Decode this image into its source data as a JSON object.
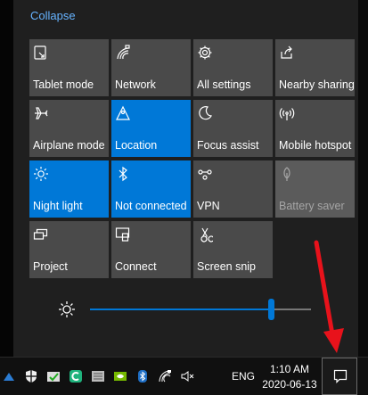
{
  "action_center": {
    "collapse_label": "Collapse",
    "tiles": [
      {
        "label": "Tablet mode",
        "state": "inactive",
        "icon": "tablet-mode-icon"
      },
      {
        "label": "Network",
        "state": "inactive",
        "icon": "network-icon"
      },
      {
        "label": "All settings",
        "state": "inactive",
        "icon": "gear-icon"
      },
      {
        "label": "Nearby sharing",
        "state": "inactive",
        "icon": "share-icon"
      },
      {
        "label": "Airplane mode",
        "state": "inactive",
        "icon": "airplane-icon"
      },
      {
        "label": "Location",
        "state": "active",
        "icon": "location-icon"
      },
      {
        "label": "Focus assist",
        "state": "inactive",
        "icon": "moon-icon"
      },
      {
        "label": "Mobile hotspot",
        "state": "inactive",
        "icon": "hotspot-icon"
      },
      {
        "label": "Night light",
        "state": "active",
        "icon": "sun-icon"
      },
      {
        "label": "Not connected",
        "state": "active",
        "icon": "bluetooth-icon"
      },
      {
        "label": "VPN",
        "state": "inactive",
        "icon": "vpn-icon"
      },
      {
        "label": "Battery saver",
        "state": "disabled",
        "icon": "battery-saver-icon"
      },
      {
        "label": "Project",
        "state": "inactive",
        "icon": "project-icon"
      },
      {
        "label": "Connect",
        "state": "inactive",
        "icon": "connect-icon"
      },
      {
        "label": "Screen snip",
        "state": "inactive",
        "icon": "screen-snip-icon"
      }
    ],
    "brightness": {
      "icon": "brightness-icon",
      "value_fraction": 0.82
    }
  },
  "taskbar": {
    "tray_icons": [
      "defender-icon",
      "security-shield-icon",
      "check-icon",
      "app-c-icon",
      "keyboard-icon",
      "nvidia-icon",
      "bluetooth-icon",
      "wifi-icon",
      "volume-muted-icon"
    ],
    "language": "ENG",
    "time": "1:10 AM",
    "date": "2020-06-13",
    "action_center_icon": "notification-icon"
  },
  "colors": {
    "accent": "#0078d7",
    "tile": "#4a4a4a",
    "link": "#66b3ff",
    "arrow": "#e8121b"
  }
}
